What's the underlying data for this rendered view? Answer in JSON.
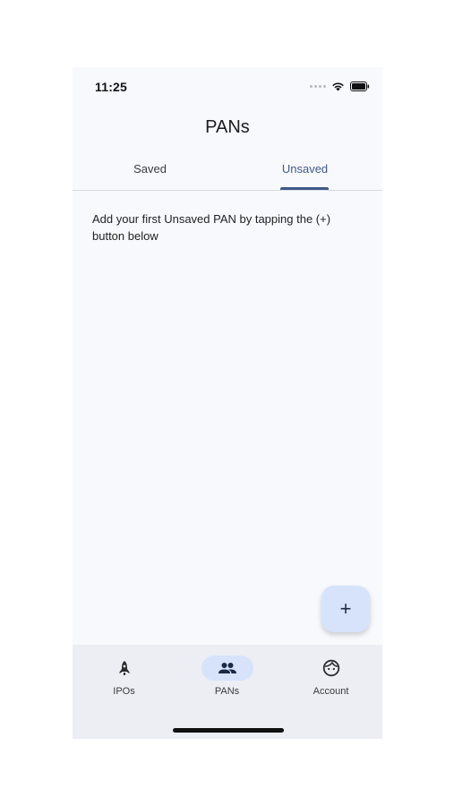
{
  "status_bar": {
    "time": "11:25",
    "icons": [
      "signal-dots-icon",
      "wifi-icon",
      "battery-icon"
    ]
  },
  "header": {
    "title": "PANs"
  },
  "tabs": [
    {
      "label": "Saved",
      "active": false
    },
    {
      "label": "Unsaved",
      "active": true
    }
  ],
  "main": {
    "empty_message": "Add your first Unsaved PAN by tapping the (+) button below"
  },
  "fab": {
    "icon": "plus-icon",
    "glyph": "+"
  },
  "bottom_nav": {
    "items": [
      {
        "label": "IPOs",
        "icon": "rocket-icon",
        "active": false
      },
      {
        "label": "PANs",
        "icon": "people-icon",
        "active": true
      },
      {
        "label": "Account",
        "icon": "face-icon",
        "active": false
      }
    ]
  },
  "colors": {
    "accent": "#3e5a8a",
    "background": "#f8f9fd",
    "nav_background": "#eceef4",
    "active_pill": "#d6e3fb"
  }
}
